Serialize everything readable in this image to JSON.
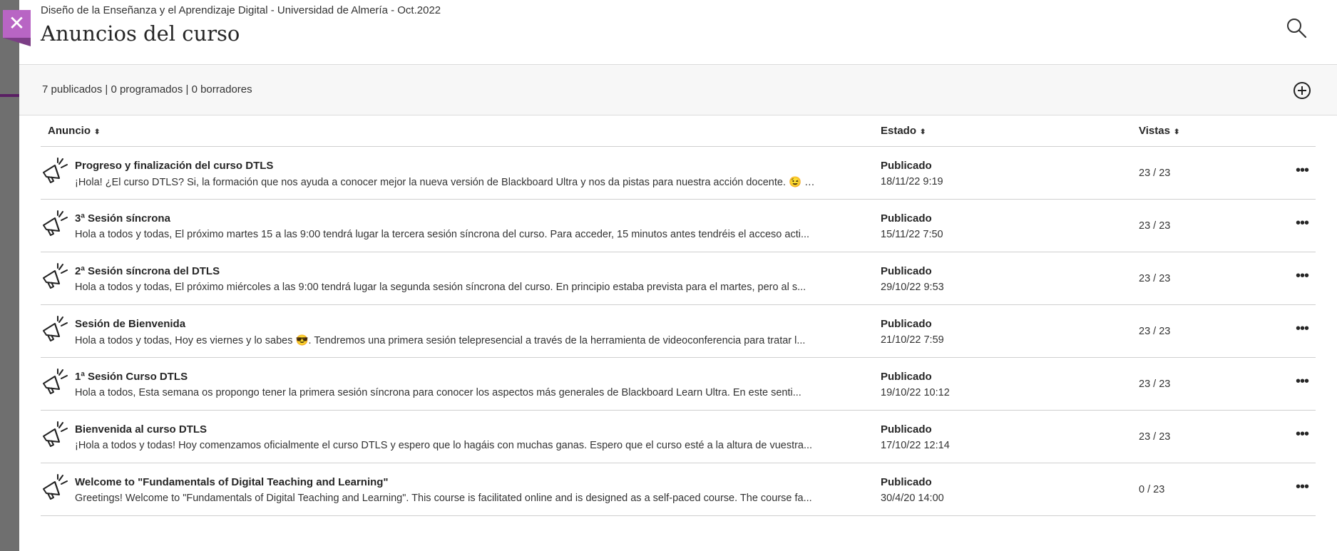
{
  "course_name": "Diseño de la Enseñanza y el Aprendizaje Digital - Universidad de Almería - Oct.2022",
  "page_title": "Anuncios del curso",
  "summary": "7 publicados | 0 programados | 0 borradores",
  "columns": {
    "anuncio": "Anuncio",
    "estado": "Estado",
    "vistas": "Vistas"
  },
  "sort_glyph": "⬍",
  "close_glyph": "✕",
  "menu_glyph": "•••",
  "accent_color": "#b865c4",
  "announcements": [
    {
      "title": "Progreso y finalización del curso DTLS",
      "excerpt": "¡Hola! ¿El curso DTLS?  Si, la formación que nos ayuda a conocer mejor la nueva versión de Blackboard Ultra y nos da pistas para nuestra acción docente. 😉 B...",
      "status": "Publicado",
      "date": "18/11/22 9:19",
      "views": "23 / 23"
    },
    {
      "title": "3ª Sesión síncrona",
      "excerpt": "Hola a todos y todas,  El próximo martes 15 a las 9:00 tendrá lugar la tercera sesión síncrona del curso.  Para acceder, 15 minutos antes tendréis el acceso acti...",
      "status": "Publicado",
      "date": "15/11/22 7:50",
      "views": "23 / 23"
    },
    {
      "title": "2ª Sesión síncrona del DTLS",
      "excerpt": "Hola a todos y todas,  El próximo miércoles a las 9:00 tendrá lugar la segunda sesión síncrona del curso.  En principio estaba prevista para el martes, pero al s...",
      "status": "Publicado",
      "date": "29/10/22 9:53",
      "views": "23 / 23"
    },
    {
      "title": "Sesión de Bienvenida",
      "excerpt": "Hola a todos y todas, Hoy es viernes y lo sabes 😎.  Tendremos una primera sesión telepresencial a través de la herramienta de videoconferencia para tratar l...",
      "status": "Publicado",
      "date": "21/10/22 7:59",
      "views": "23 / 23"
    },
    {
      "title": "1ª Sesión Curso DTLS",
      "excerpt": "Hola a todos,  Esta semana os propongo tener la  primera sesión síncrona  para conocer los aspectos más generales de Blackboard Learn Ultra.  En este senti...",
      "status": "Publicado",
      "date": "19/10/22 10:12",
      "views": "23 / 23"
    },
    {
      "title": "Bienvenida al curso DTLS",
      "excerpt": "¡Hola a todos y todas! Hoy comenzamos oficialmente el  curso DTLS  y espero que lo hagáis con muchas ganas.  Espero que el curso esté a la altura de vuestra...",
      "status": "Publicado",
      "date": "17/10/22 12:14",
      "views": "23 / 23"
    },
    {
      "title": "Welcome to \"Fundamentals of Digital Teaching and Learning\"",
      "excerpt": "Greetings! Welcome to \"Fundamentals of Digital Teaching and Learning\". This course is facilitated online and is designed as a self-paced course. The course fa...",
      "status": "Publicado",
      "date": "30/4/20 14:00",
      "views": "0 / 23"
    }
  ]
}
